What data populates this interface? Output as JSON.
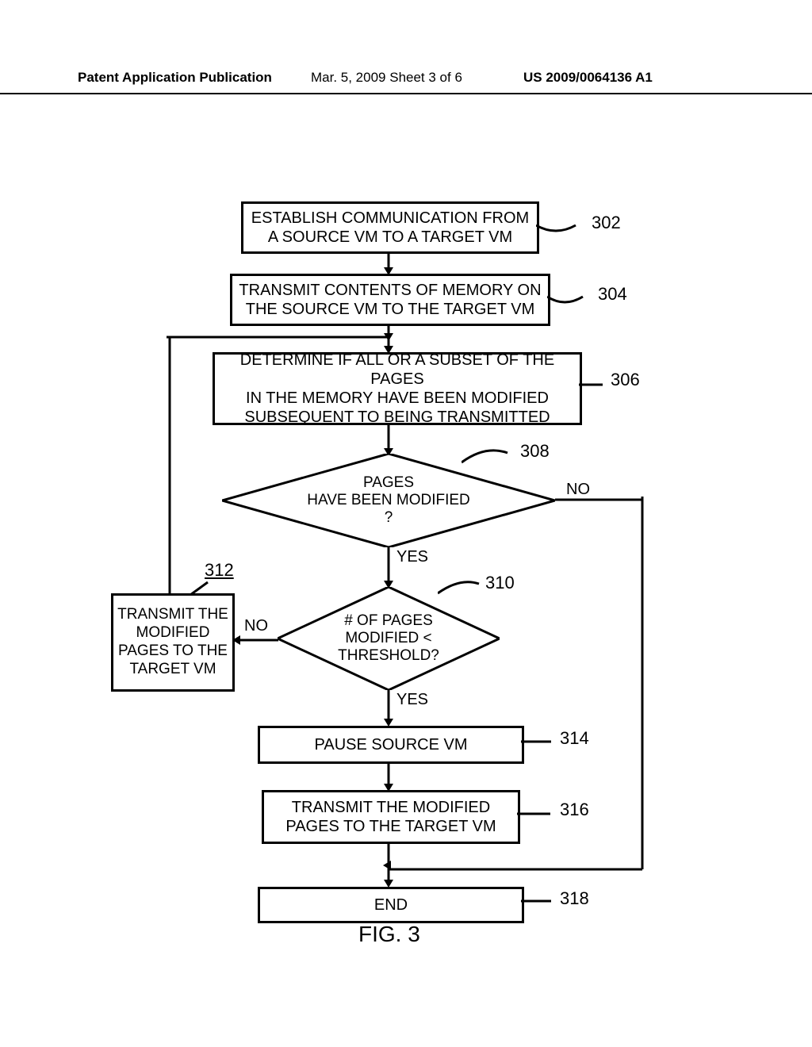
{
  "header": {
    "left": "Patent Application Publication",
    "mid": "Mar. 5, 2009   Sheet 3 of 6",
    "right": "US 2009/0064136 A1"
  },
  "boxes": {
    "b302_l1": "ESTABLISH COMMUNICATION FROM",
    "b302_l2": "A SOURCE VM TO A TARGET VM",
    "b304_l1": "TRANSMIT CONTENTS OF MEMORY ON",
    "b304_l2": "THE SOURCE VM TO THE TARGET VM",
    "b306_l1": "DETERMINE IF ALL OR A SUBSET OF THE PAGES",
    "b306_l2": "IN THE MEMORY HAVE BEEN MODIFIED",
    "b306_l3": "SUBSEQUENT TO BEING TRANSMITTED",
    "b312_l1": "TRANSMIT THE",
    "b312_l2": "MODIFIED",
    "b312_l3": "PAGES TO THE",
    "b312_l4": "TARGET VM",
    "b314": "PAUSE SOURCE VM",
    "b316_l1": "TRANSMIT THE MODIFIED",
    "b316_l2": "PAGES TO THE TARGET VM",
    "b318": "END"
  },
  "diamonds": {
    "d308_l1": "PAGES",
    "d308_l2": "HAVE BEEN MODIFIED",
    "d308_l3": "?",
    "d310_l1": "# OF PAGES",
    "d310_l2": "MODIFIED <",
    "d310_l3": "THRESHOLD?"
  },
  "labels": {
    "yes": "YES",
    "no": "NO"
  },
  "refs": {
    "r302": "302",
    "r304": "304",
    "r306": "306",
    "r308": "308",
    "r310": "310",
    "r312": "312",
    "r314": "314",
    "r316": "316",
    "r318": "318"
  },
  "figure": "FIG. 3"
}
